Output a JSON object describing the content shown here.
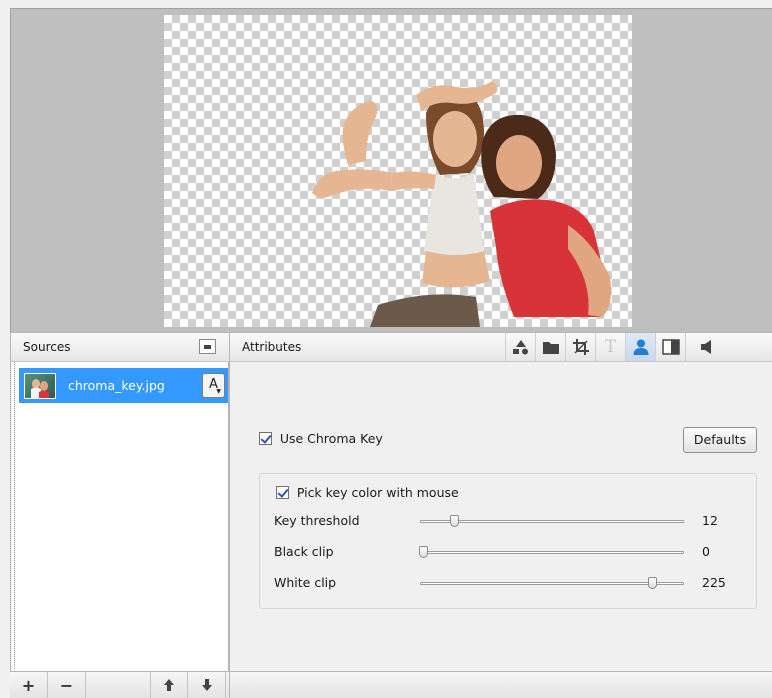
{
  "panels": {
    "sources_title": "Sources",
    "attributes_title": "Attributes"
  },
  "sources": {
    "items": [
      {
        "name": "chroma_key.jpg",
        "badge": "A",
        "selected": true
      }
    ]
  },
  "attribute_tabs": [
    {
      "icon": "shapes-icon",
      "active": false
    },
    {
      "icon": "folder-icon",
      "active": false
    },
    {
      "icon": "crop-icon",
      "active": false
    },
    {
      "icon": "text-icon",
      "label": "T",
      "active": false
    },
    {
      "icon": "person-icon",
      "active": true
    },
    {
      "icon": "split-panel-icon",
      "active": false
    },
    {
      "icon": "speaker-icon",
      "active": false
    }
  ],
  "chroma": {
    "use_label": "Use Chroma Key",
    "use_checked": true,
    "defaults_label": "Defaults",
    "pick_label": "Pick key color with mouse",
    "pick_checked": true,
    "sliders": [
      {
        "label": "Key threshold",
        "value": "12",
        "fraction": 0.13
      },
      {
        "label": "Black clip",
        "value": "0",
        "fraction": 0.01
      },
      {
        "label": "White clip",
        "value": "225",
        "fraction": 0.88
      }
    ]
  },
  "bottom_toolbar": [
    {
      "icon": "add-icon",
      "label": "+"
    },
    {
      "icon": "remove-icon",
      "label": "−"
    },
    {
      "icon": "move-up-icon",
      "label": "🡅"
    },
    {
      "icon": "move-down-icon",
      "label": "🡇"
    }
  ],
  "colors": {
    "selection": "#3399ff",
    "active_tab_icon": "#1e7fd8",
    "checkbox_mark": "#2f55a8"
  }
}
